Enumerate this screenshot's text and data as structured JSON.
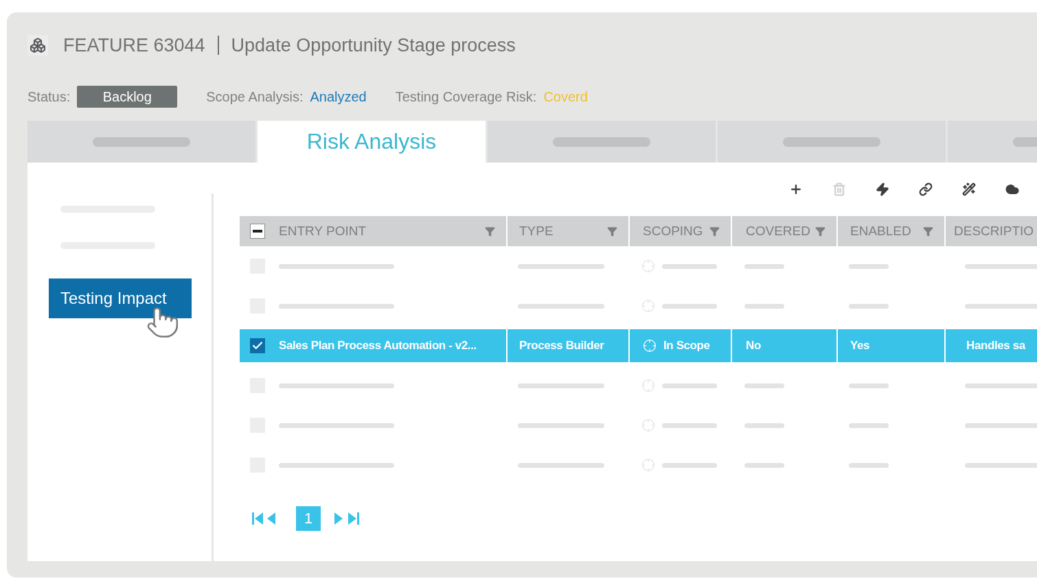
{
  "header": {
    "feature_id": "FEATURE 63044",
    "title": "Update Opportunity Stage process"
  },
  "status_bar": [
    {
      "kind": "badge",
      "label": "Status:",
      "value": "Backlog"
    },
    {
      "kind": "link",
      "label": "Scope Analysis:",
      "value": "Analyzed"
    },
    {
      "kind": "warning",
      "label": "Testing Coverage Risk:",
      "value": "Coverd"
    }
  ],
  "tabs": [
    {
      "selected": false
    },
    {
      "label": "Risk Analysis",
      "selected": true
    },
    {
      "selected": false
    },
    {
      "selected": false
    },
    {
      "selected": false
    }
  ],
  "sidebar": {
    "items": [
      {
        "selected": false
      },
      {
        "selected": false
      },
      {
        "label": "Testing Impact",
        "selected": true
      }
    ]
  },
  "toolbar": [
    {
      "kind": "add",
      "disabled": false
    },
    {
      "kind": "delete",
      "disabled": true
    },
    {
      "kind": "run",
      "disabled": false
    },
    {
      "kind": "link",
      "disabled": false
    },
    {
      "kind": "magic",
      "disabled": false
    },
    {
      "kind": "cloud",
      "disabled": false
    }
  ],
  "table": {
    "select_all": {
      "indeterminate": true
    },
    "columns": [
      "ENTRY POINT",
      "TYPE",
      "SCOPING",
      "COVERED",
      "ENABLED",
      "DESCRIPTIO"
    ],
    "rows": [
      {
        "kind": "placeholder",
        "checked": false
      },
      {
        "kind": "placeholder",
        "checked": false
      },
      {
        "kind": "data",
        "checked": true,
        "cells": [
          "Sales Plan Process Automation - v2...",
          "Process Builder",
          "In Scope",
          "No",
          "Yes",
          "Handles sa"
        ]
      },
      {
        "kind": "placeholder",
        "checked": false
      },
      {
        "kind": "placeholder",
        "checked": false
      },
      {
        "kind": "placeholder",
        "checked": false
      }
    ]
  },
  "pagination": {
    "page": "1"
  }
}
